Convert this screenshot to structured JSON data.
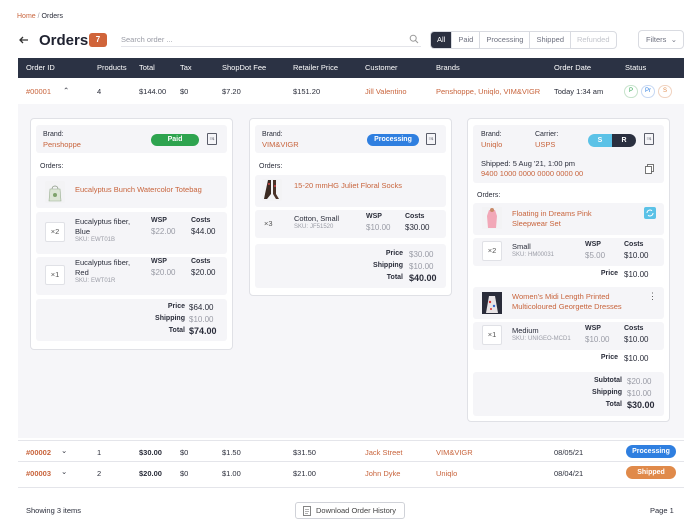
{
  "breadcrumb": {
    "home": "Home",
    "sep": "/",
    "current": "Orders"
  },
  "header": {
    "title": "Orders",
    "count": "7",
    "search_placeholder": "Search order ..."
  },
  "filters": {
    "tabs": [
      "All",
      "Paid",
      "Processing",
      "Shipped",
      "Refunded"
    ],
    "active": "All",
    "button": "Filters"
  },
  "table": {
    "columns": [
      "Order ID",
      "Products",
      "Total",
      "Tax",
      "ShopDot Fee",
      "Retailer Price",
      "Customer",
      "Brands",
      "Order Date",
      "Status"
    ],
    "rows": [
      {
        "id": "#00001",
        "products": "4",
        "total": "$144.00",
        "tax": "$0",
        "fee": "$7.20",
        "retail": "$151.20",
        "customer": "Jill Valentino",
        "brands": "Penshoppe, Uniqlo, VIM&VIGR",
        "date": "Today 1:34 am",
        "status_chips": [
          "P",
          "Pr",
          "S"
        ]
      },
      {
        "id": "#00002",
        "products": "1",
        "total": "$30.00",
        "tax": "$0",
        "fee": "$1.50",
        "retail": "$31.50",
        "customer": "Jack Street",
        "brands": "VIM&VIGR",
        "date": "08/05/21",
        "status": "Processing"
      },
      {
        "id": "#00003",
        "products": "2",
        "total": "$20.00",
        "tax": "$0",
        "fee": "$1.00",
        "retail": "$21.00",
        "customer": "John Dyke",
        "brands": "Uniqlo",
        "date": "08/04/21",
        "status": "Shipped"
      }
    ]
  },
  "cards": {
    "penshoppe": {
      "brand_label": "Brand:",
      "brand": "Penshoppe",
      "status": "Paid",
      "orders_label": "Orders:",
      "product": "Eucalyptus Bunch Watercolor Totebag",
      "variants": [
        {
          "qty": "×2",
          "name1": "Eucalyptus fiber,",
          "name2": "Blue",
          "sku_label": "SKU:",
          "sku": "EWT01B",
          "wsp_label": "WSP",
          "wsp": "$22.00",
          "costs_label": "Costs",
          "costs": "$44.00"
        },
        {
          "qty": "×1",
          "name1": "Eucalyptus fiber,",
          "name2": "Red",
          "sku_label": "SKU:",
          "sku": "EWT01R",
          "wsp_label": "WSP",
          "wsp": "$20.00",
          "costs_label": "Costs",
          "costs": "$20.00"
        }
      ],
      "price_label": "Price",
      "price": "$64.00",
      "shipping_label": "Shipping",
      "shipping": "$10.00",
      "total_label": "Total",
      "total": "$74.00"
    },
    "vimvigr": {
      "brand_label": "Brand:",
      "brand": "VIM&VIGR",
      "status": "Processing",
      "orders_label": "Orders:",
      "product": "15-20 mmHG Juliet Floral Socks",
      "variant": {
        "qty": "×3",
        "name": "Cotton, Small",
        "sku_label": "SKU:",
        "sku": "JF51520",
        "wsp_label": "WSP",
        "wsp": "$10.00",
        "costs_label": "Costs",
        "costs": "$30.00"
      },
      "price_label": "Price",
      "price": "$30.00",
      "shipping_label": "Shipping",
      "shipping": "$10.00",
      "total_label": "Total",
      "total": "$40.00"
    },
    "uniqlo": {
      "brand_label": "Brand:",
      "brand": "Uniqlo",
      "carrier_label": "Carrier:",
      "carrier": "USPS",
      "toggle": [
        "S",
        "R"
      ],
      "shipped": "Shipped: 5 Aug '21, 1:00 pm",
      "tracking": "9400 1000 0000 0000 0000 00",
      "orders_label": "Orders:",
      "item1": {
        "product1": "Floating in Dreams Pink",
        "product2": "Sleepwear Set",
        "qty": "×2",
        "name": "Small",
        "sku_label": "SKU:",
        "sku": "HM00031",
        "wsp_label": "WSP",
        "wsp": "$5.00",
        "costs_label": "Costs",
        "costs": "$10.00",
        "price_label": "Price",
        "price": "$10.00"
      },
      "item2": {
        "product1": "Women's Midi Length Printed",
        "product2": "Multicoloured Georgette Dresses",
        "qty": "×1",
        "name": "Medium",
        "sku_label": "SKU:",
        "sku": "UNIGEO-MCD1",
        "wsp_label": "WSP",
        "wsp": "$10.00",
        "costs_label": "Costs",
        "costs": "$10.00",
        "price_label": "Price",
        "price": "$10.00"
      },
      "subtotal_label": "Subtotal",
      "subtotal": "$20.00",
      "shipping_label": "Shipping",
      "shipping": "$10.00",
      "total_label": "Total",
      "total": "$30.00"
    }
  },
  "footer": {
    "showing": "Showing 3 items",
    "download": "Download Order History",
    "page": "Page 1"
  },
  "colors": {
    "accent": "#c8643c",
    "header_bg": "#2b3244",
    "paid": "#2ea44f",
    "processing": "#2f7fe0",
    "shipped": "#e08a4a"
  }
}
